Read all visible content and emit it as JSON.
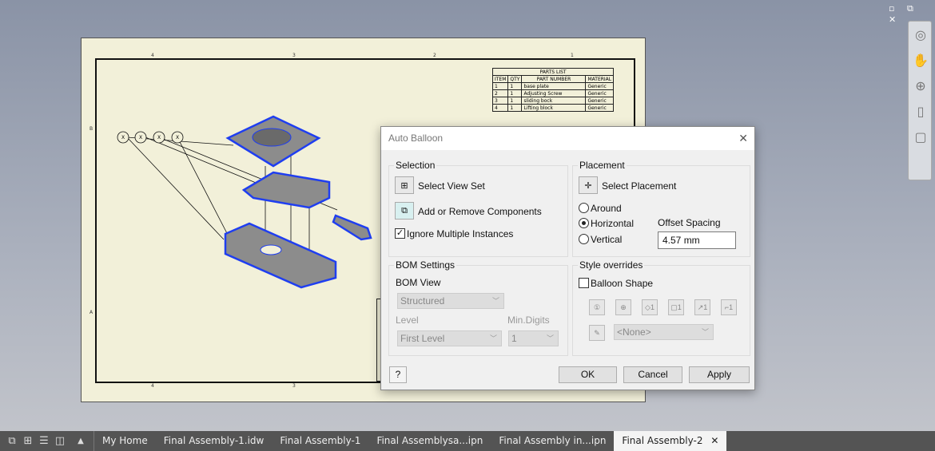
{
  "window": {
    "controls": "▫ ⧉ ✕"
  },
  "sheet": {
    "zone_top": [
      "4",
      "3",
      "2",
      "1"
    ],
    "zone_bottom": [
      "4",
      "3",
      "2",
      "1"
    ],
    "zone_left": [
      "B",
      "A"
    ],
    "balloon_text": "X",
    "parts_list": {
      "title": "PARTS LIST",
      "headers": [
        "ITEM",
        "QTY",
        "PART NUMBER",
        "MATERIAL"
      ],
      "rows": [
        [
          "1",
          "1",
          "base plate",
          "Generic"
        ],
        [
          "2",
          "1",
          "Adjusting Screw",
          "Generic"
        ],
        [
          "3",
          "1",
          "sliding bock",
          "Generic"
        ],
        [
          "4",
          "1",
          "Lifting block",
          "Generic"
        ]
      ]
    }
  },
  "nav_bar": {
    "icons": [
      "steering-wheel-icon",
      "pan-hand-icon",
      "zoom-icon",
      "zoom-sheet-icon",
      "zoom-window-icon"
    ]
  },
  "dialog": {
    "title": "Auto Balloon",
    "close": "✕",
    "selection": {
      "label": "Selection",
      "select_view_set": "Select View Set",
      "add_remove": "Add or Remove Components",
      "ignore_multiple": "Ignore Multiple Instances",
      "ignore_multiple_checked": true
    },
    "placement": {
      "label": "Placement",
      "select_placement": "Select Placement",
      "options": [
        "Around",
        "Horizontal",
        "Vertical"
      ],
      "selected": "Horizontal",
      "offset_label": "Offset Spacing",
      "offset_value": "4.57 mm"
    },
    "bom": {
      "label": "BOM Settings",
      "view_label": "BOM View",
      "view_value": "Structured",
      "level_label": "Level",
      "level_value": "First Level",
      "min_digits_label": "Min.Digits",
      "min_digits_value": "1"
    },
    "style": {
      "label": "Style overrides",
      "balloon_shape": "Balloon Shape",
      "balloon_shape_checked": false,
      "shape_icons": [
        "①",
        "⊕",
        "◇1",
        "▢1",
        "↗1",
        "⌐1"
      ],
      "style_value": "<None>"
    },
    "help": "?",
    "ok": "OK",
    "cancel": "Cancel",
    "apply": "Apply"
  },
  "tabs": {
    "layout_icons": [
      "cascade-icon",
      "tile-icon",
      "horizontal-icon",
      "vertical-icon"
    ],
    "up": "▲",
    "items": [
      {
        "label": "My Home"
      },
      {
        "label": "Final Assembly-1.idw"
      },
      {
        "label": "Final Assembly-1"
      },
      {
        "label": "Final Assemblysa...ipn"
      },
      {
        "label": "Final Assembly in...ipn"
      },
      {
        "label": "Final Assembly-2",
        "active": true
      }
    ],
    "close": "✕"
  }
}
